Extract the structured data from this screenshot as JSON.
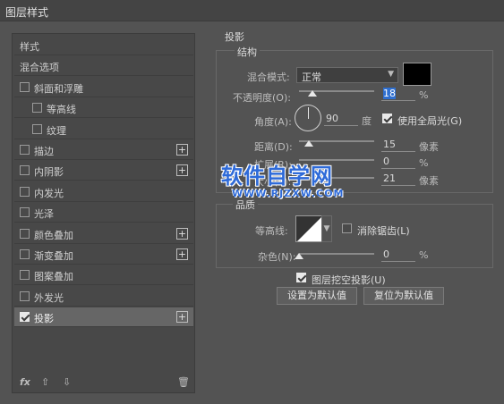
{
  "window": {
    "title": "图层样式"
  },
  "sidebar": {
    "items": [
      {
        "label": "样式",
        "checkbox": false,
        "checked": false,
        "plus": false,
        "selected": false,
        "indent": 0
      },
      {
        "label": "混合选项",
        "checkbox": false,
        "checked": false,
        "plus": false,
        "selected": false,
        "indent": 0
      },
      {
        "label": "斜面和浮雕",
        "checkbox": true,
        "checked": false,
        "plus": false,
        "selected": false,
        "indent": 0
      },
      {
        "label": "等高线",
        "checkbox": true,
        "checked": false,
        "plus": false,
        "selected": false,
        "indent": 1
      },
      {
        "label": "纹理",
        "checkbox": true,
        "checked": false,
        "plus": false,
        "selected": false,
        "indent": 1
      },
      {
        "label": "描边",
        "checkbox": true,
        "checked": false,
        "plus": true,
        "selected": false,
        "indent": 0
      },
      {
        "label": "内阴影",
        "checkbox": true,
        "checked": false,
        "plus": true,
        "selected": false,
        "indent": 0
      },
      {
        "label": "内发光",
        "checkbox": true,
        "checked": false,
        "plus": false,
        "selected": false,
        "indent": 0
      },
      {
        "label": "光泽",
        "checkbox": true,
        "checked": false,
        "plus": false,
        "selected": false,
        "indent": 0
      },
      {
        "label": "颜色叠加",
        "checkbox": true,
        "checked": false,
        "plus": true,
        "selected": false,
        "indent": 0
      },
      {
        "label": "渐变叠加",
        "checkbox": true,
        "checked": false,
        "plus": true,
        "selected": false,
        "indent": 0
      },
      {
        "label": "图案叠加",
        "checkbox": true,
        "checked": false,
        "plus": false,
        "selected": false,
        "indent": 0
      },
      {
        "label": "外发光",
        "checkbox": true,
        "checked": false,
        "plus": false,
        "selected": false,
        "indent": 0
      },
      {
        "label": "投影",
        "checkbox": true,
        "checked": true,
        "plus": true,
        "selected": true,
        "indent": 0
      }
    ],
    "footer": {
      "fx": "fx",
      "up": "⇧",
      "down": "⇩",
      "trash": "🗑"
    }
  },
  "panel": {
    "section_title": "投影",
    "structure": {
      "title": "结构",
      "blend_mode_label": "混合模式:",
      "blend_mode_value": "正常",
      "shadow_color": "#000000",
      "opacity_label": "不透明度(O):",
      "opacity_value": "18",
      "opacity_unit": "%",
      "opacity_level": 0.18,
      "angle_label": "角度(A):",
      "angle_value": "90",
      "angle_unit": "度",
      "global_light_label": "使用全局光(G)",
      "global_light_checked": true,
      "distance_label": "距离(D):",
      "distance_value": "15",
      "distance_unit": "像素",
      "spread_label": "扩展(R):",
      "spread_value": "0",
      "spread_unit": "%",
      "size_label": "大小(S):",
      "size_value": "21",
      "size_unit": "像素"
    },
    "quality": {
      "title": "品质",
      "contour_label": "等高线:",
      "antialias_label": "消除锯齿(L)",
      "antialias_checked": false,
      "noise_label": "杂色(N):",
      "noise_value": "0",
      "noise_unit": "%"
    },
    "knockout_label": "图层挖空投影(U)",
    "knockout_checked": true,
    "btn_default": "设置为默认值",
    "btn_reset": "复位为默认值"
  },
  "watermark": {
    "main": "软件自学网",
    "url": "WWW.RJZXW.COM"
  }
}
